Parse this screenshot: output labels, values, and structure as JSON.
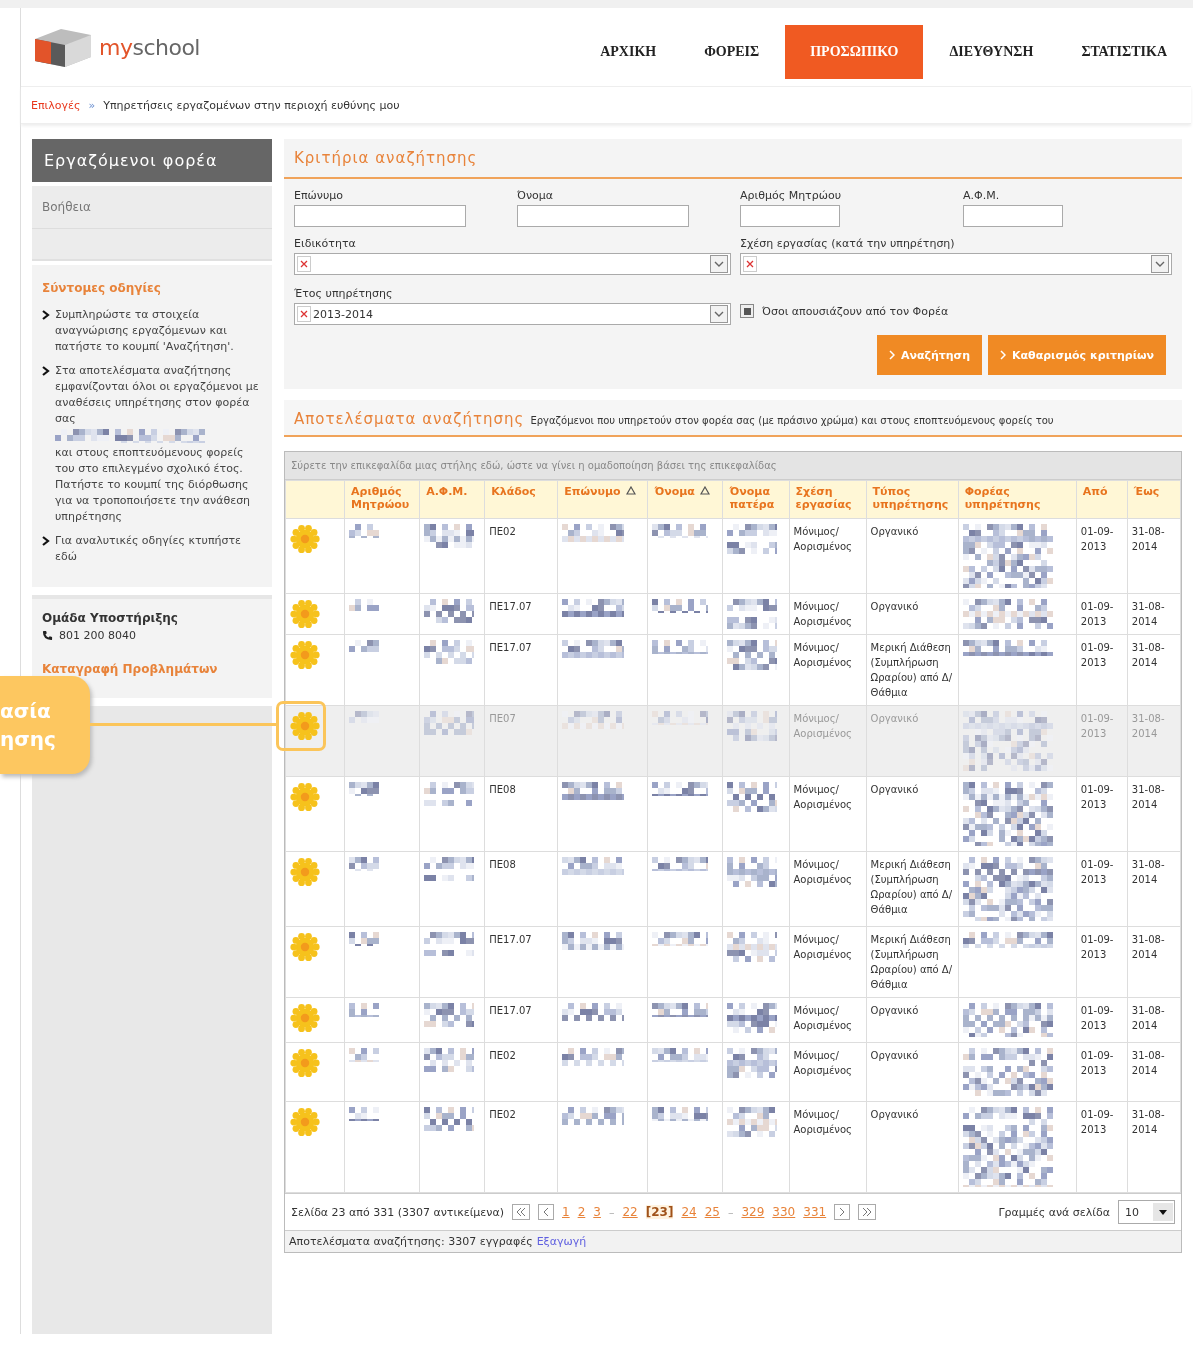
{
  "header": {
    "logo": {
      "prefix": "my",
      "name": "school"
    },
    "nav": [
      {
        "label": "ΑΡΧΙΚΗ",
        "selected": false
      },
      {
        "label": "ΦΟΡΕΙΣ",
        "selected": false
      },
      {
        "label": "ΠΡΟΣΩΠΙΚΟ",
        "selected": true
      },
      {
        "label": "ΔΙΕΥΘΥΝΣΗ",
        "selected": false
      },
      {
        "label": "ΣΤΑΤΙΣΤΙΚΑ",
        "selected": false
      }
    ]
  },
  "breadcrumb": {
    "root": "Επιλογές",
    "separator": "»",
    "current": "Υπηρετήσεις εργαζομένων στην περιοχή ευθύνης μου"
  },
  "sidebar": {
    "title": "Εργαζόμενοι φορέα",
    "items": [
      "Βοήθεια"
    ],
    "instructions": {
      "title": "Σύντομες οδηγίες",
      "items": [
        {
          "parts": [
            "Συμπληρώστε τα στοιχεία αναγνώρισης εργαζόμενων και πατήστε το κουμπί 'Αναζήτηση'."
          ]
        },
        {
          "parts": [
            "Στα αποτελέσματα αναζήτησης εμφανίζονται όλοι οι εργαζόμενοι με αναθέσεις υπηρέτησης στον φορέα σας",
            "και στους εποπτευόμενους φορείς του στο επιλεγμένο σχολικό έτος. Πατήστε το κουμπί της διόρθωσης για να τροποποιήσετε την ανάθεση υπηρέτησης"
          ]
        },
        {
          "parts": [
            "Για αναλυτικές οδηγίες κτυπήστε εδώ"
          ]
        }
      ]
    },
    "support": {
      "title": "Ομάδα Υποστήριξης",
      "phone": "801 200 8040",
      "link": "Καταγραφή Προβλημάτων"
    }
  },
  "search": {
    "title": "Κριτήρια αναζήτησης",
    "fields": [
      {
        "label": "Επώνυμο"
      },
      {
        "label": "Όνομα"
      },
      {
        "label": "Αριθμός Μητρώου"
      },
      {
        "label": "Α.Φ.Μ."
      }
    ],
    "selects": [
      {
        "label": "Ειδικότητα"
      },
      {
        "label": "Σχέση εργασίας (κατά την υπηρέτηση)"
      },
      {
        "label": "Έτος υπηρέτησης",
        "value": "2013-2014"
      }
    ],
    "checkbox": {
      "label": "Όσοι απουσιάζουν από τον Φορέα",
      "checked": true
    },
    "buttons": [
      "Αναζήτηση",
      "Καθαρισμός κριτηρίων"
    ]
  },
  "results": {
    "title": "Αποτελέσματα αναζήτησης",
    "description": "Εργαζόμενοι που υπηρετούν στον φορέα σας (με πράσινο χρώμα) και στους εποπτευόμενους φορείς του",
    "group_hint": "Σύρετε την επικεφαλίδα μιας στήλης εδώ, ώστε να γίνει η ομαδοποίηση βάσει της επικεφαλίδας",
    "columns": [
      {
        "label": "Αριθμός Μητρώου",
        "sorted": false
      },
      {
        "label": "Α.Φ.Μ.",
        "sorted": false
      },
      {
        "label": "Κλάδος",
        "sorted": false
      },
      {
        "label": "Επώνυμο",
        "sorted": true
      },
      {
        "label": "Όνομα",
        "sorted": true
      },
      {
        "label": "Όνομα πατέρα",
        "sorted": false
      },
      {
        "label": "Σχέση εργασίας",
        "sorted": false
      },
      {
        "label": "Τύπος υπηρέτησης",
        "sorted": false
      },
      {
        "label": "Φορέας υπηρέτησης",
        "sorted": false
      },
      {
        "label": "Από",
        "sorted": false
      },
      {
        "label": "Έως",
        "sorted": false
      }
    ],
    "rows": [
      {
        "branch": "ΠΕ02",
        "relation": "Μόνιμος/Αορισμένος",
        "service": "Οργανικό",
        "from": "01-09-2013",
        "to": "31-08-2014",
        "disabled": false
      },
      {
        "branch": "ΠΕ17.07",
        "relation": "Μόνιμος/Αορισμένος",
        "service": "Οργανικό",
        "from": "01-09-2013",
        "to": "31-08-2014",
        "disabled": false
      },
      {
        "branch": "ΠΕ17.07",
        "relation": "Μόνιμος/Αορισμένος",
        "service": "Μερική Διάθεση (Συμπλήρωση Ωραρίου) από Δ/Θάθμια",
        "from": "01-09-2013",
        "to": "31-08-2014",
        "disabled": false
      },
      {
        "branch": "ΠΕ07",
        "relation": "Μόνιμος/Αορισμένος",
        "service": "Οργανικό",
        "from": "01-09-2013",
        "to": "31-08-2014",
        "disabled": true
      },
      {
        "branch": "ΠΕ08",
        "relation": "Μόνιμος/Αορισμένος",
        "service": "Οργανικό",
        "from": "01-09-2013",
        "to": "31-08-2014",
        "disabled": false
      },
      {
        "branch": "ΠΕ08",
        "relation": "Μόνιμος/Αορισμένος",
        "service": "Μερική Διάθεση (Συμπλήρωση Ωραρίου) από Δ/Θάθμια",
        "from": "01-09-2013",
        "to": "31-08-2014",
        "disabled": false
      },
      {
        "branch": "ΠΕ17.07",
        "relation": "Μόνιμος/Αορισμένος",
        "service": "Μερική Διάθεση (Συμπλήρωση Ωραρίου) από Δ/Θάθμια",
        "from": "01-09-2013",
        "to": "31-08-2014",
        "disabled": false
      },
      {
        "branch": "ΠΕ17.07",
        "relation": "Μόνιμος/Αορισμένος",
        "service": "Οργανικό",
        "from": "01-09-2013",
        "to": "31-08-2014",
        "disabled": false
      },
      {
        "branch": "ΠΕ02",
        "relation": "Μόνιμος/Αορισμένος",
        "service": "Οργανικό",
        "from": "01-09-2013",
        "to": "31-08-2014",
        "disabled": false
      },
      {
        "branch": "ΠΕ02",
        "relation": "Μόνιμος/Αορισμένος",
        "service": "Οργανικό",
        "from": "01-09-2013",
        "to": "31-08-2014",
        "disabled": false
      }
    ],
    "pager": {
      "summary": "Σελίδα 23 από 331 (3307 αντικείμενα)",
      "pages": [
        {
          "label": "1",
          "kind": "link",
          "selected": false
        },
        {
          "label": "2",
          "kind": "link",
          "selected": false
        },
        {
          "label": "3",
          "kind": "link",
          "selected": false
        },
        {
          "label": "–",
          "kind": "gap"
        },
        {
          "label": "22",
          "kind": "link",
          "selected": false
        },
        {
          "label": "[23]",
          "kind": "link",
          "selected": true
        },
        {
          "label": "24",
          "kind": "link",
          "selected": false
        },
        {
          "label": "25",
          "kind": "link",
          "selected": false
        },
        {
          "label": "–",
          "kind": "gap"
        },
        {
          "label": "329",
          "kind": "link",
          "selected": false
        },
        {
          "label": "330",
          "kind": "link",
          "selected": false
        },
        {
          "label": "331",
          "kind": "link",
          "selected": false
        }
      ],
      "rows_label": "Γραμμές ανά σελίδα",
      "rows_value": "10"
    },
    "footer": {
      "text": "Αποτελέσματα αναζήτησης: 3307 εγγραφές",
      "link": "Εξαγωγή"
    }
  },
  "callout": {
    "lines": [
      "ασία",
      "ησης"
    ]
  }
}
